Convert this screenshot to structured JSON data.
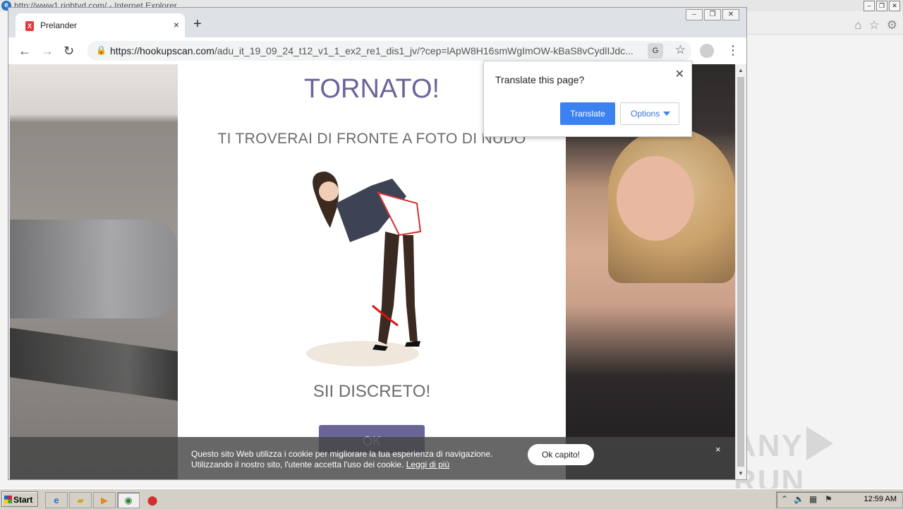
{
  "ie": {
    "title": "http://www1.rightyd.com/ - Internet Explorer",
    "window_buttons": [
      "–",
      "❐",
      "✕"
    ],
    "tool_icons": [
      "⌂",
      "☆",
      "⚙"
    ]
  },
  "watermark": {
    "left": "ANY",
    "right": "RUN"
  },
  "chrome": {
    "tab_title": "Prelander",
    "tab_close": "×",
    "new_tab": "+",
    "window_buttons": [
      "–",
      "❐",
      "✕"
    ],
    "nav": {
      "back": "←",
      "forward": "→",
      "reload": "↻"
    },
    "url_host": "https://hookupscan.com",
    "url_path": "/adu_it_19_09_24_t12_v1_1_ex2_re1_dis1_jv/?cep=lApW8H16smWgImOW-kBaS8vCydlIJdc...",
    "translate_icon": "G",
    "star": "☆",
    "menu": "⋮"
  },
  "page": {
    "headline": "TORNATO!",
    "subline": "TI TROVERAI DI FRONTE A FOTO DI NUDO",
    "discreet": "SII DISCRETO!",
    "ok_button": "OK"
  },
  "cookie": {
    "line1": "Questo sito Web utilizza i cookie per migliorare la tua esperienza di navigazione.",
    "line2": "Utilizzando il nostro sito, l'utente accetta l'uso dei cookie.",
    "link": "Leggi di più",
    "accept": "Ok capito!",
    "close": "×"
  },
  "translate_popup": {
    "question": "Translate this page?",
    "translate": "Translate",
    "options": "Options",
    "close": "✕"
  },
  "taskbar": {
    "start": "Start",
    "clock": "12:59 AM"
  },
  "colors": {
    "accent_purple": "#6a6597",
    "translate_blue": "#3b82f0"
  }
}
